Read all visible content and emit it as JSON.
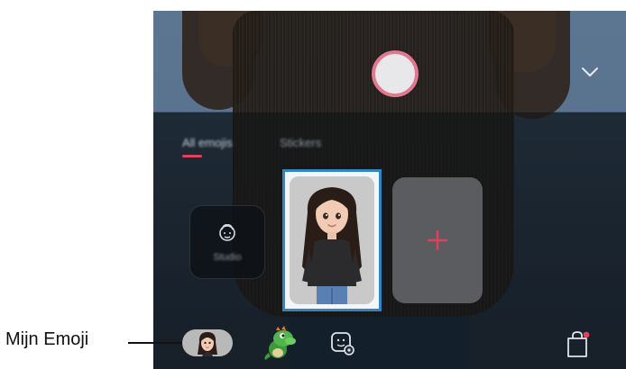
{
  "callout": {
    "label": "Mijn Emoji"
  },
  "emoji_tabs": {
    "all_emojis": "All emojis",
    "stickers": "Stickers"
  },
  "studio": {
    "label": "Studio"
  },
  "colors": {
    "accent": "#e0415c",
    "highlight_border": "#2f86c2",
    "capture_ring": "#e07990"
  },
  "icons": {
    "collapse": "chevron-down-icon",
    "studio": "face-outline-icon",
    "add": "plus-icon",
    "sticker_settings": "sticker-settings-icon",
    "store": "shopping-bag-icon"
  }
}
